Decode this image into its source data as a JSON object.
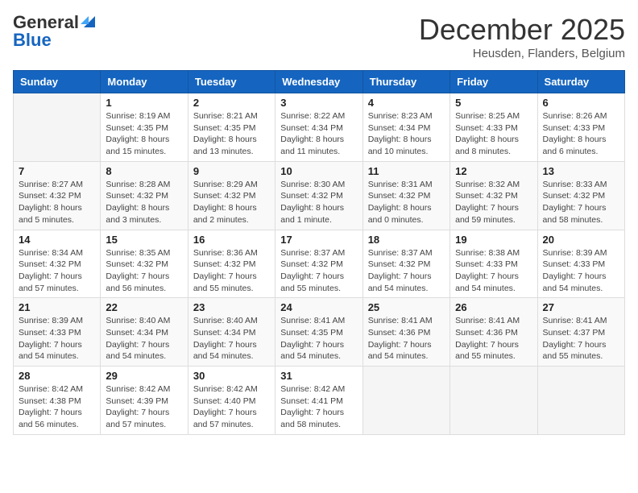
{
  "header": {
    "logo_general": "General",
    "logo_blue": "Blue",
    "month_title": "December 2025",
    "subtitle": "Heusden, Flanders, Belgium"
  },
  "weekdays": [
    "Sunday",
    "Monday",
    "Tuesday",
    "Wednesday",
    "Thursday",
    "Friday",
    "Saturday"
  ],
  "weeks": [
    [
      {
        "day": "",
        "info": ""
      },
      {
        "day": "1",
        "info": "Sunrise: 8:19 AM\nSunset: 4:35 PM\nDaylight: 8 hours\nand 15 minutes."
      },
      {
        "day": "2",
        "info": "Sunrise: 8:21 AM\nSunset: 4:35 PM\nDaylight: 8 hours\nand 13 minutes."
      },
      {
        "day": "3",
        "info": "Sunrise: 8:22 AM\nSunset: 4:34 PM\nDaylight: 8 hours\nand 11 minutes."
      },
      {
        "day": "4",
        "info": "Sunrise: 8:23 AM\nSunset: 4:34 PM\nDaylight: 8 hours\nand 10 minutes."
      },
      {
        "day": "5",
        "info": "Sunrise: 8:25 AM\nSunset: 4:33 PM\nDaylight: 8 hours\nand 8 minutes."
      },
      {
        "day": "6",
        "info": "Sunrise: 8:26 AM\nSunset: 4:33 PM\nDaylight: 8 hours\nand 6 minutes."
      }
    ],
    [
      {
        "day": "7",
        "info": "Sunrise: 8:27 AM\nSunset: 4:32 PM\nDaylight: 8 hours\nand 5 minutes."
      },
      {
        "day": "8",
        "info": "Sunrise: 8:28 AM\nSunset: 4:32 PM\nDaylight: 8 hours\nand 3 minutes."
      },
      {
        "day": "9",
        "info": "Sunrise: 8:29 AM\nSunset: 4:32 PM\nDaylight: 8 hours\nand 2 minutes."
      },
      {
        "day": "10",
        "info": "Sunrise: 8:30 AM\nSunset: 4:32 PM\nDaylight: 8 hours\nand 1 minute."
      },
      {
        "day": "11",
        "info": "Sunrise: 8:31 AM\nSunset: 4:32 PM\nDaylight: 8 hours\nand 0 minutes."
      },
      {
        "day": "12",
        "info": "Sunrise: 8:32 AM\nSunset: 4:32 PM\nDaylight: 7 hours\nand 59 minutes."
      },
      {
        "day": "13",
        "info": "Sunrise: 8:33 AM\nSunset: 4:32 PM\nDaylight: 7 hours\nand 58 minutes."
      }
    ],
    [
      {
        "day": "14",
        "info": "Sunrise: 8:34 AM\nSunset: 4:32 PM\nDaylight: 7 hours\nand 57 minutes."
      },
      {
        "day": "15",
        "info": "Sunrise: 8:35 AM\nSunset: 4:32 PM\nDaylight: 7 hours\nand 56 minutes."
      },
      {
        "day": "16",
        "info": "Sunrise: 8:36 AM\nSunset: 4:32 PM\nDaylight: 7 hours\nand 55 minutes."
      },
      {
        "day": "17",
        "info": "Sunrise: 8:37 AM\nSunset: 4:32 PM\nDaylight: 7 hours\nand 55 minutes."
      },
      {
        "day": "18",
        "info": "Sunrise: 8:37 AM\nSunset: 4:32 PM\nDaylight: 7 hours\nand 54 minutes."
      },
      {
        "day": "19",
        "info": "Sunrise: 8:38 AM\nSunset: 4:33 PM\nDaylight: 7 hours\nand 54 minutes."
      },
      {
        "day": "20",
        "info": "Sunrise: 8:39 AM\nSunset: 4:33 PM\nDaylight: 7 hours\nand 54 minutes."
      }
    ],
    [
      {
        "day": "21",
        "info": "Sunrise: 8:39 AM\nSunset: 4:33 PM\nDaylight: 7 hours\nand 54 minutes."
      },
      {
        "day": "22",
        "info": "Sunrise: 8:40 AM\nSunset: 4:34 PM\nDaylight: 7 hours\nand 54 minutes."
      },
      {
        "day": "23",
        "info": "Sunrise: 8:40 AM\nSunset: 4:34 PM\nDaylight: 7 hours\nand 54 minutes."
      },
      {
        "day": "24",
        "info": "Sunrise: 8:41 AM\nSunset: 4:35 PM\nDaylight: 7 hours\nand 54 minutes."
      },
      {
        "day": "25",
        "info": "Sunrise: 8:41 AM\nSunset: 4:36 PM\nDaylight: 7 hours\nand 54 minutes."
      },
      {
        "day": "26",
        "info": "Sunrise: 8:41 AM\nSunset: 4:36 PM\nDaylight: 7 hours\nand 55 minutes."
      },
      {
        "day": "27",
        "info": "Sunrise: 8:41 AM\nSunset: 4:37 PM\nDaylight: 7 hours\nand 55 minutes."
      }
    ],
    [
      {
        "day": "28",
        "info": "Sunrise: 8:42 AM\nSunset: 4:38 PM\nDaylight: 7 hours\nand 56 minutes."
      },
      {
        "day": "29",
        "info": "Sunrise: 8:42 AM\nSunset: 4:39 PM\nDaylight: 7 hours\nand 57 minutes."
      },
      {
        "day": "30",
        "info": "Sunrise: 8:42 AM\nSunset: 4:40 PM\nDaylight: 7 hours\nand 57 minutes."
      },
      {
        "day": "31",
        "info": "Sunrise: 8:42 AM\nSunset: 4:41 PM\nDaylight: 7 hours\nand 58 minutes."
      },
      {
        "day": "",
        "info": ""
      },
      {
        "day": "",
        "info": ""
      },
      {
        "day": "",
        "info": ""
      }
    ]
  ]
}
